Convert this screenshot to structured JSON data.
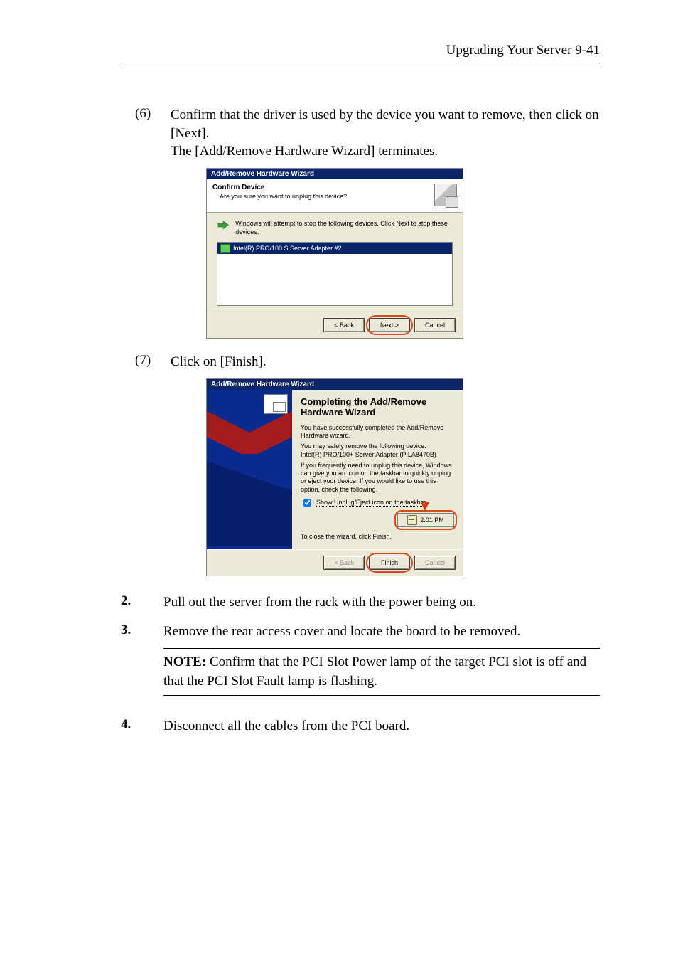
{
  "header": {
    "running_head": "Upgrading Your Server   9-41"
  },
  "substep6": {
    "num": "(6)",
    "line1": "Confirm that the driver is used by the device you want to remove, then click on [Next].",
    "line2": "The [Add/Remove Hardware Wizard] terminates."
  },
  "substep7": {
    "num": "(7)",
    "line1": "Click on [Finish]."
  },
  "wiz1": {
    "title": "Add/Remove Hardware Wizard",
    "hdr_t1": "Confirm Device",
    "hdr_t2": "Are you sure you want to unplug this device?",
    "body_msg": "Windows will attempt to stop the following devices.  Click Next to stop these devices.",
    "list_item": "Intel(R) PRO/100 S Server Adapter #2",
    "btn_back": "< Back",
    "btn_next": "Next >",
    "btn_cancel": "Cancel"
  },
  "wiz2": {
    "title": "Add/Remove Hardware Wizard",
    "heading": "Completing the Add/Remove Hardware Wizard",
    "p1": "You have successfully completed the Add/Remove Hardware wizard.",
    "p2": "You may safely remove the following device:",
    "p2b": "Intel(R) PRO/100+ Server Adapter (PILA8470B)",
    "p3": "If you frequently need to unplug this device, Windows can give you an icon on the taskbar to quickly unplug or eject your device. If you would like to use this option, check the following.",
    "cb_label": "Show Unplug/Eject icon on the taskbar",
    "tray_time": "2:01 PM",
    "p4": "To close the wizard, click Finish.",
    "btn_back": "< Back",
    "btn_finish": "Finish",
    "btn_cancel": "Cancel"
  },
  "steps": {
    "s2_num": "2.",
    "s2_txt": "Pull out the server from the rack with the power being on.",
    "s3_num": "3.",
    "s3_txt": "Remove the rear access cover and locate the board to be removed.",
    "s4_num": "4.",
    "s4_txt": "Disconnect all the cables from the PCI board."
  },
  "note": {
    "label": "NOTE:",
    "text": " Confirm that the PCI Slot Power lamp of the target PCI slot is off and that the PCI Slot Fault lamp is flashing."
  }
}
